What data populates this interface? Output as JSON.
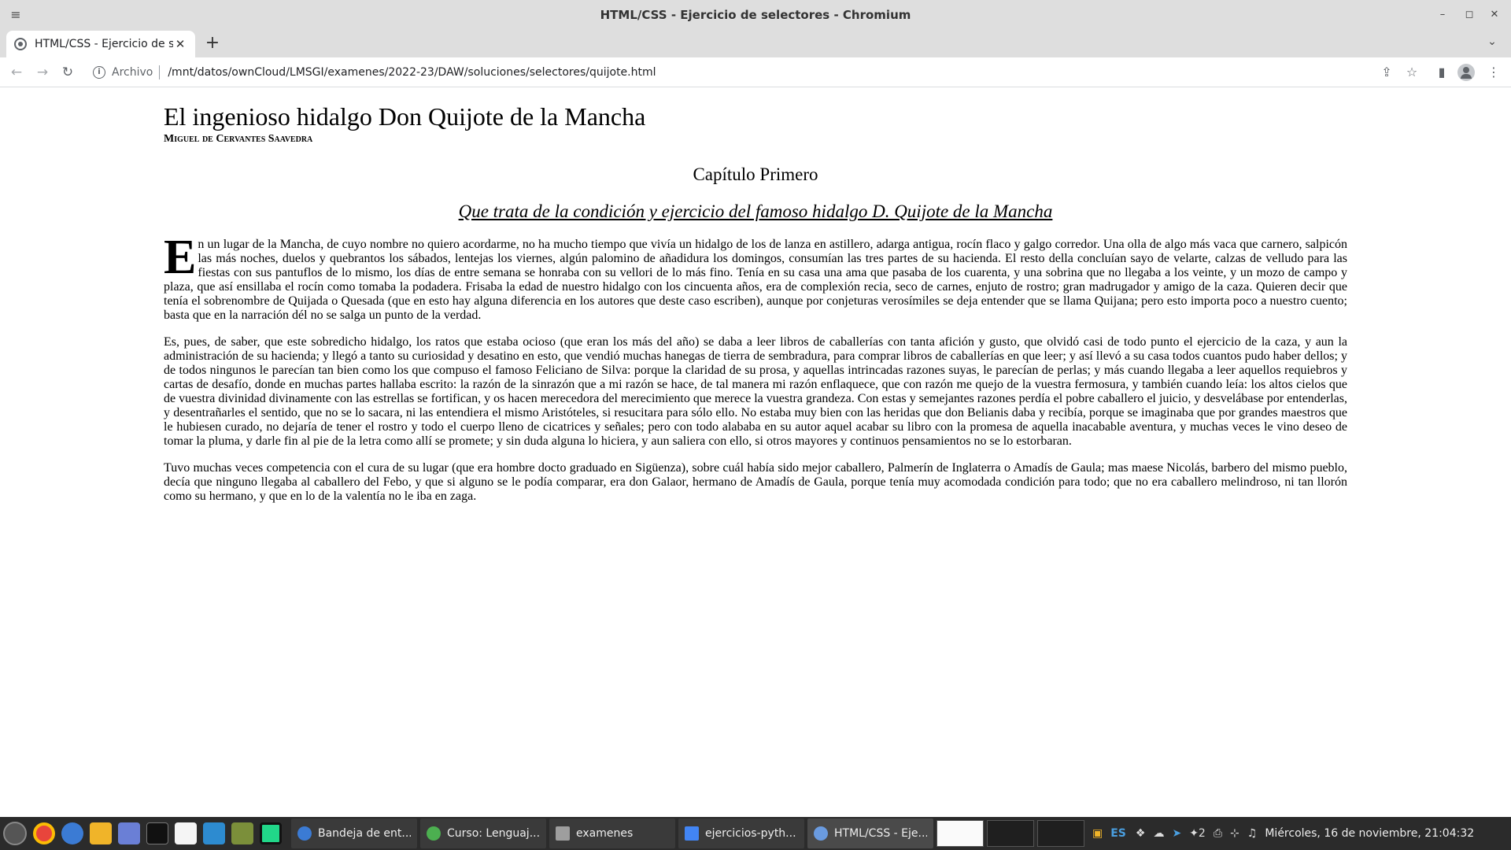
{
  "window": {
    "title": "HTML/CSS - Ejercicio de selectores - Chromium",
    "minimize": "–",
    "maximize": "◻",
    "close": "✕",
    "menu": "≡"
  },
  "tab": {
    "title": "HTML/CSS - Ejercicio de selectores",
    "close": "✕",
    "new_tab": "+",
    "tab_search": "⌄"
  },
  "toolbar": {
    "back": "←",
    "forward": "→",
    "reload": "↻",
    "scheme_label": "Archivo",
    "url": "/mnt/datos/ownCloud/LMSGI/examenes/2022-23/DAW/soluciones/selectores/quijote.html",
    "share": "⇪",
    "bookmark": "☆",
    "sidepanel": "▮",
    "more": "⋮"
  },
  "document": {
    "title": "El ingenioso hidalgo Don Quijote de la Mancha",
    "author": "Miguel de Cervantes Saavedra",
    "chapter": "Capítulo Primero",
    "subtitle": "Que trata de la condición y ejercicio del famoso hidalgo D. Quijote de la Mancha",
    "dropcap": "E",
    "paragraph1": "n un lugar de la Mancha, de cuyo nombre no quiero acordarme, no ha mucho tiempo que vivía un hidalgo de los de lanza en astillero, adarga antigua, rocín flaco y galgo corredor. Una olla de algo más vaca que carnero, salpicón las más noches, duelos y quebrantos los sábados, lentejas los viernes, algún palomino de añadidura los domingos, consumían las tres partes de su hacienda. El resto della concluían sayo de velarte, calzas de velludo para las fiestas con sus pantuflos de lo mismo, los días de entre semana se honraba con su vellori de lo más fino. Tenía en su casa una ama que pasaba de los cuarenta, y una sobrina que no llegaba a los veinte, y un mozo de campo y plaza, que así ensillaba el rocín como tomaba la podadera. Frisaba la edad de nuestro hidalgo con los cincuenta años, era de complexión recia, seco de carnes, enjuto de rostro; gran madrugador y amigo de la caza. Quieren decir que tenía el sobrenombre de Quijada o Quesada (que en esto hay alguna diferencia en los autores que deste caso escriben), aunque por conjeturas verosímiles se deja entender que se llama Quijana; pero esto importa poco a nuestro cuento; basta que en la narración dél no se salga un punto de la verdad.",
    "paragraph2": "Es, pues, de saber, que este sobredicho hidalgo, los ratos que estaba ocioso (que eran los más del año) se daba a leer libros de caballerías con tanta afición y gusto, que olvidó casi de todo punto el ejercicio de la caza, y aun la administración de su hacienda; y llegó a tanto su curiosidad y desatino en esto, que vendió muchas hanegas de tierra de sembradura, para comprar libros de caballerías en que leer; y así llevó a su casa todos cuantos pudo haber dellos; y de todos ningunos le parecían tan bien como los que compuso el famoso Feliciano de Silva: porque la claridad de su prosa, y aquellas intrincadas razones suyas, le parecían de perlas; y más cuando llegaba a leer aquellos requiebros y cartas de desafío, donde en muchas partes hallaba escrito: la razón de la sinrazón que a mi razón se hace, de tal manera mi razón enflaquece, que con razón me quejo de la vuestra fermosura, y también cuando leía: los altos cielos que de vuestra divinidad divinamente con las estrellas se fortifican, y os hacen merecedora del merecimiento que merece la vuestra grandeza. Con estas y semejantes razones perdía el pobre caballero el juicio, y desvelábase por entenderlas, y desentrañarles el sentido, que no se lo sacara, ni las entendiera el mismo Aristóteles, si resucitara para sólo ello. No estaba muy bien con las heridas que don Belianis daba y recibía, porque se imaginaba que por grandes maestros que le hubiesen curado, no dejaría de tener el rostro y todo el cuerpo lleno de cicatrices y señales; pero con todo alababa en su autor aquel acabar su libro con la promesa de aquella inacabable aventura, y muchas veces le vino deseo de tomar la pluma, y darle fin al pie de la letra como allí se promete; y sin duda alguna lo hiciera, y aun saliera con ello, si otros mayores y continuos pensamientos no se lo estorbaran.",
    "paragraph3": "Tuvo muchas veces competencia con el cura de su lugar (que era hombre docto graduado en Sigüenza), sobre cuál había sido mejor caballero, Palmerín de Inglaterra o Amadís de Gaula; mas maese Nicolás, barbero del mismo pueblo, decía que ninguno llegaba al caballero del Febo, y que si alguno se le podía comparar, era don Galaor, hermano de Amadís de Gaula, porque tenía muy acomodada condición para todo; que no era caballero melindroso, ni tan llorón como su hermano, y que en lo de la valentía no le iba en zaga."
  },
  "taskbar": {
    "windows": [
      {
        "label": "Bandeja de ent...",
        "icon": "thunderbird-icon",
        "color": "#3b7bd4"
      },
      {
        "label": "Curso: Lenguaj...",
        "icon": "chrome-icon",
        "color": "#4caf50"
      },
      {
        "label": "examenes",
        "icon": "folder-icon",
        "color": "#9e9e9e"
      },
      {
        "label": "ejercicios-pyth...",
        "icon": "document-icon",
        "color": "#4285f4"
      },
      {
        "label": "HTML/CSS - Eje...",
        "icon": "chromium-icon",
        "color": "#6a9be0"
      }
    ],
    "tray_count": "2",
    "lang": "ES",
    "clock": "Miércoles, 16 de noviembre, 21:04:32"
  }
}
